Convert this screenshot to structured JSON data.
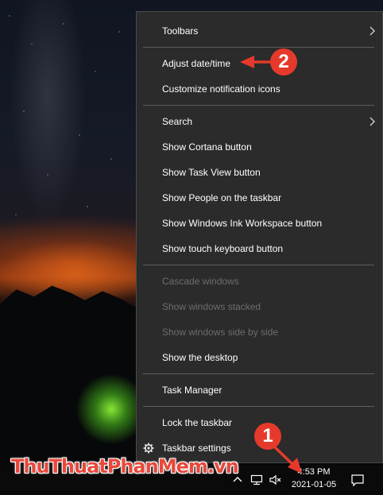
{
  "context_menu": {
    "items": [
      {
        "label": "Toolbars",
        "has_submenu": true,
        "enabled": true
      },
      {
        "label": "Adjust date/time",
        "has_submenu": false,
        "enabled": true
      },
      {
        "label": "Customize notification icons",
        "has_submenu": false,
        "enabled": true
      },
      {
        "label": "Search",
        "has_submenu": true,
        "enabled": true
      },
      {
        "label": "Show Cortana button",
        "has_submenu": false,
        "enabled": true
      },
      {
        "label": "Show Task View button",
        "has_submenu": false,
        "enabled": true
      },
      {
        "label": "Show People on the taskbar",
        "has_submenu": false,
        "enabled": true
      },
      {
        "label": "Show Windows Ink Workspace button",
        "has_submenu": false,
        "enabled": true
      },
      {
        "label": "Show touch keyboard button",
        "has_submenu": false,
        "enabled": true
      },
      {
        "label": "Cascade windows",
        "has_submenu": false,
        "enabled": false
      },
      {
        "label": "Show windows stacked",
        "has_submenu": false,
        "enabled": false
      },
      {
        "label": "Show windows side by side",
        "has_submenu": false,
        "enabled": false
      },
      {
        "label": "Show the desktop",
        "has_submenu": false,
        "enabled": true
      },
      {
        "label": "Task Manager",
        "has_submenu": false,
        "enabled": true
      },
      {
        "label": "Lock the taskbar",
        "has_submenu": false,
        "enabled": true
      },
      {
        "label": "Taskbar settings",
        "has_submenu": false,
        "enabled": true,
        "icon": "gear-icon"
      }
    ]
  },
  "taskbar": {
    "clock_time": "4:53 PM",
    "clock_date": "2021-01-05",
    "tray_icons": [
      "chevron-up-icon",
      "network-icon",
      "volume-muted-icon",
      "notification-icon"
    ]
  },
  "annotations": {
    "step1": "1",
    "step2": "2",
    "color": "#e53a2b"
  },
  "watermark": {
    "text": "ThuThuatPhanMem",
    "suffix": ".vn"
  },
  "colors": {
    "menu_bg": "#2b2b2b",
    "menu_text": "#ffffff",
    "menu_disabled_text": "#6d6d6d",
    "separator": "#5d5d5d",
    "taskbar_bg": "#0a0a0a"
  }
}
